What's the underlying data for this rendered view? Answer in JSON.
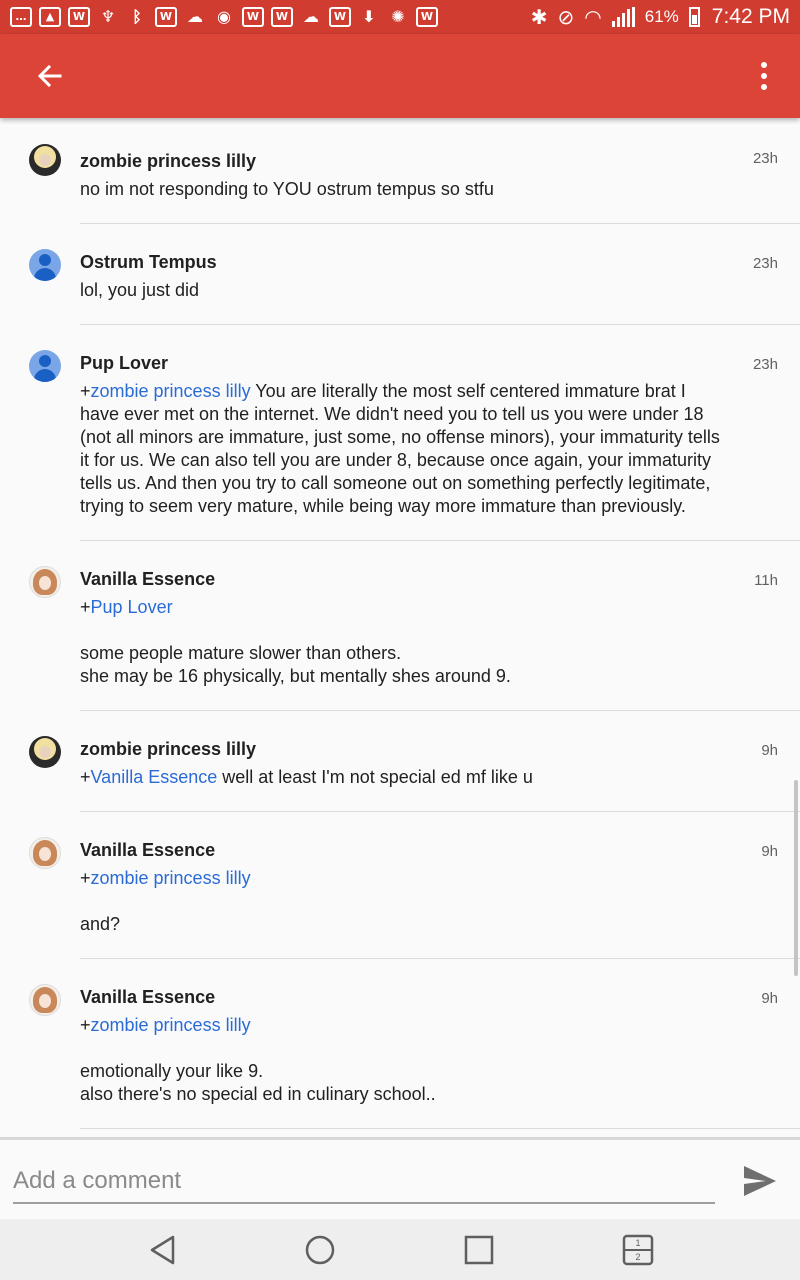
{
  "status_bar": {
    "battery": "61%",
    "time": "7:42 PM",
    "notification_icons": [
      "photos-icon",
      "ic-w",
      "ic-p",
      "bluetooth-icon",
      "ic-w",
      "cloud-icon",
      "wifi-icon",
      "ic-w",
      "ic-w",
      "cloud-icon",
      "ic-w",
      "download-icon",
      "sd-icon",
      "ic-w"
    ]
  },
  "app_bar": {
    "back_icon": "arrow-back-icon",
    "more_icon": "more-vert-icon",
    "color": "#db4437"
  },
  "comments": [
    {
      "author": "zombie princess lilly",
      "time": "23h",
      "avatar": "zombie",
      "mention": "",
      "text_lines": [
        "no im not responding to YOU ostrum tempus so stfu"
      ]
    },
    {
      "author": "Ostrum Tempus",
      "time": "23h",
      "avatar": "default",
      "mention": "",
      "text_lines": [
        "lol, you just did"
      ]
    },
    {
      "author": "Pup Lover",
      "time": "23h",
      "avatar": "default",
      "mention": "zombie princess lilly",
      "inline_text": " You are literally the most self centered immature brat I have ever met on the internet. We didn't need you to tell us you were under 18 (not all minors are immature, just some, no offense minors), your immaturity tells it for us. We can also tell you are under 8, because once again, your immaturity tells us. And then you try to call someone out on something perfectly legitimate, trying to seem very mature, while being way more immature than previously."
    },
    {
      "author": "Vanilla Essence",
      "time": "11h",
      "avatar": "vanilla",
      "mention": "Pup Lover",
      "text_lines": [
        "some people mature slower than others.",
        "she may be 16 physically, but mentally shes around 9."
      ]
    },
    {
      "author": "zombie princess lilly",
      "time": "9h",
      "avatar": "zombie",
      "mention": "Vanilla Essence",
      "inline_text": " well at least I'm not special ed mf like u"
    },
    {
      "author": "Vanilla Essence",
      "time": "9h",
      "avatar": "vanilla",
      "mention": "zombie princess lilly",
      "text_lines": [
        "and?"
      ]
    },
    {
      "author": "Vanilla Essence",
      "time": "9h",
      "avatar": "vanilla",
      "mention": "zombie princess lilly",
      "text_lines": [
        "emotionally your like 9.",
        "also there's no special ed in culinary school.."
      ]
    }
  ],
  "plus": "+",
  "composer": {
    "placeholder": "Add a comment",
    "send_icon": "send-icon"
  },
  "nav_bar": {
    "buttons": [
      "back-triangle-icon",
      "home-circle-icon",
      "recents-square-icon",
      "dual-window-icon"
    ],
    "dual_window_top": "1",
    "dual_window_bottom": "2"
  }
}
